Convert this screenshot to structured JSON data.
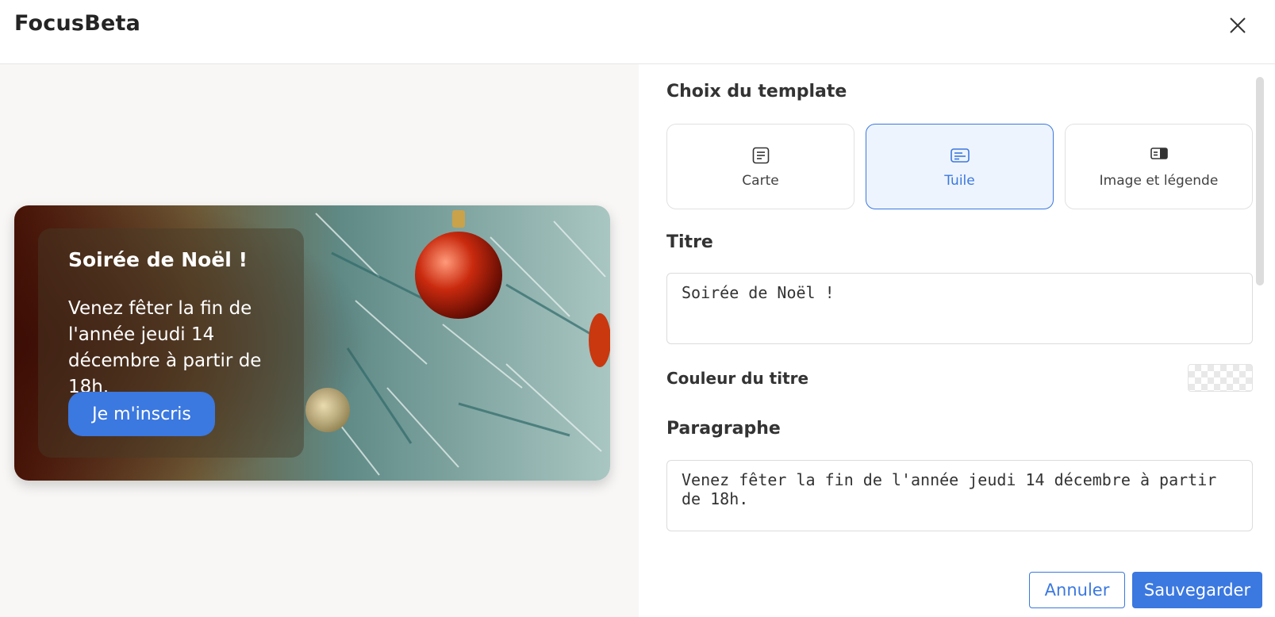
{
  "app": {
    "title": "FocusBeta"
  },
  "header": {
    "close_icon": "close-icon"
  },
  "preview": {
    "tile_title": "Soirée de Noël !",
    "tile_text": "Venez fêter la fin de l'année jeudi 14 décembre à partir de 18h.",
    "tile_button": "Je m'inscris",
    "accent_color": "#3b78e0"
  },
  "settings": {
    "template_section_label": "Choix du template",
    "templates": [
      {
        "label": "Carte",
        "icon": "card-template-icon",
        "selected": false
      },
      {
        "label": "Tuile",
        "icon": "tile-template-icon",
        "selected": true
      },
      {
        "label": "Image et légende",
        "icon": "image-caption-template-icon",
        "selected": false
      }
    ],
    "title_section_label": "Titre",
    "title_value": "Soirée de Noël !",
    "title_color_label": "Couleur du titre",
    "paragraph_section_label": "Paragraphe",
    "paragraph_value": "Venez fêter la fin de l'année jeudi 14 décembre à partir de 18h."
  },
  "footer": {
    "cancel_label": "Annuler",
    "save_label": "Sauvegarder"
  }
}
